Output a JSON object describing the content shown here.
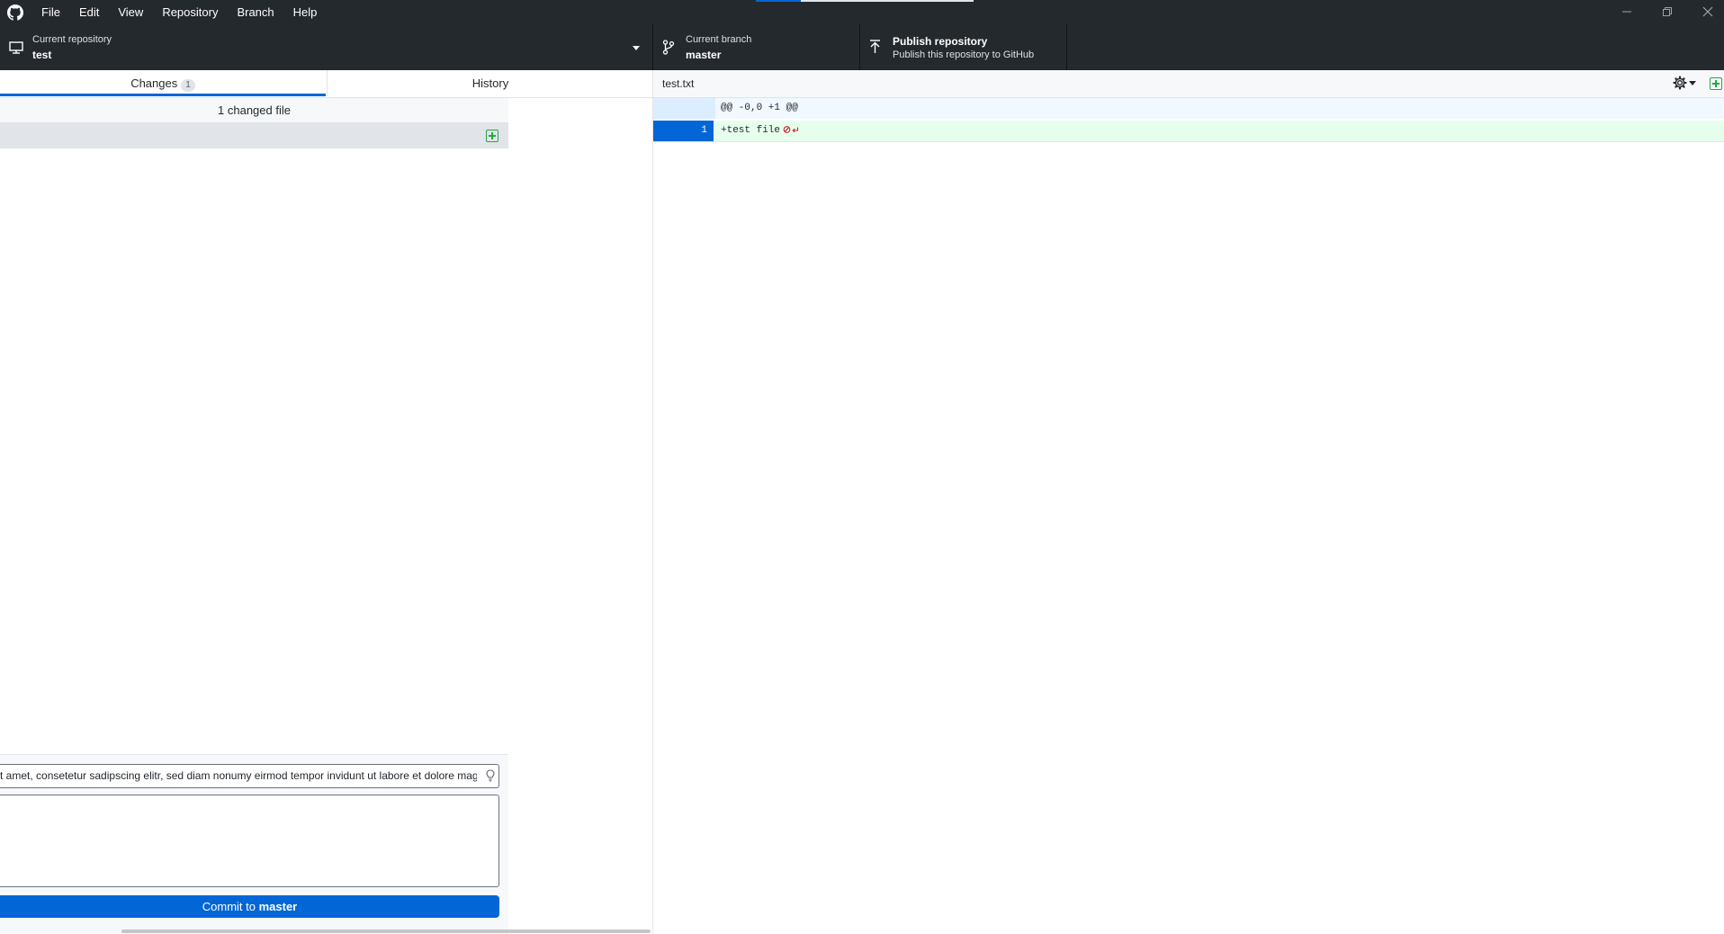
{
  "titlebar": {
    "menu": [
      "File",
      "Edit",
      "View",
      "Repository",
      "Branch",
      "Help"
    ]
  },
  "toolbar": {
    "repository": {
      "label": "Current repository",
      "value": "test"
    },
    "branch": {
      "label": "Current branch",
      "value": "master"
    },
    "publish": {
      "title": "Publish repository",
      "subtitle": "Publish this repository to GitHub"
    }
  },
  "tabs": {
    "changes": {
      "label": "Changes",
      "count": "1"
    },
    "history": {
      "label": "History"
    }
  },
  "changes": {
    "header": "1 changed file"
  },
  "commit": {
    "summary_value": "t amet, consetetur sadipscing elitr, sed diam nonumy eirmod tempor invidunt ut labore et dolore mag",
    "button_prefix": "Commit to ",
    "button_branch": "master"
  },
  "diff": {
    "filename": "test.txt",
    "hunk_header": "@@ -0,0 +1 @@",
    "lines": [
      {
        "number": "1",
        "text": "+test file"
      }
    ]
  },
  "colors": {
    "accent": "#0366d6",
    "added": "#28a745",
    "chrome": "#24292e"
  }
}
